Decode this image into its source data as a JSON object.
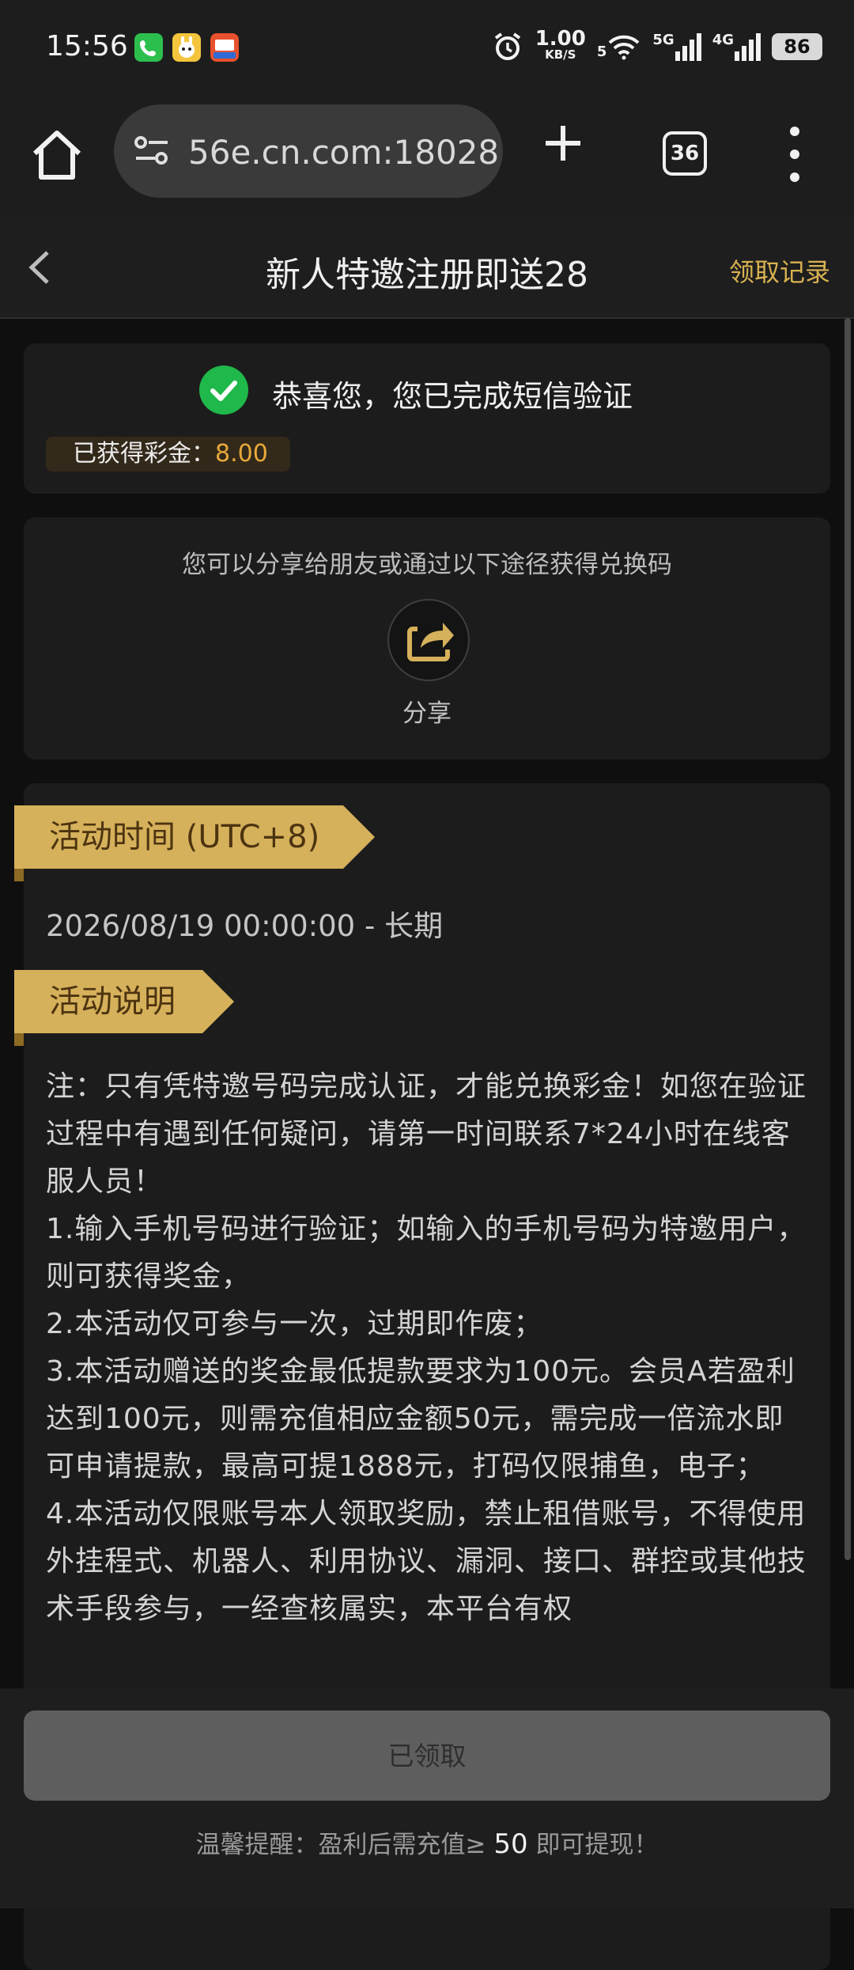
{
  "status_bar": {
    "time": "15:56",
    "speed_value": "1.00",
    "speed_unit": "KB/S",
    "wifi_label": "5",
    "signal1_label": "5G",
    "signal2_label": "4G",
    "battery": "86"
  },
  "browser": {
    "url": "56e.cn.com:18028",
    "tab_count": "36"
  },
  "header": {
    "title": "新人特邀注册即送28",
    "records_link": "领取记录"
  },
  "verification": {
    "message": "恭喜您，您已完成短信验证",
    "bonus_label": "已获得彩金：",
    "bonus_value": "8.00"
  },
  "share": {
    "hint": "您可以分享给朋友或通过以下途径获得兑换码",
    "label": "分享"
  },
  "activity": {
    "time_heading": "活动时间 (UTC+8)",
    "time_range": "2026/08/19 00:00:00 - 长期",
    "desc_heading": "活动说明",
    "desc_lines": [
      "注：只有凭特邀号码完成认证，才能兑换彩金！如您在验证过程中有遇到任何疑问，请第一时间联系7*24小时在线客服人员！",
      "1.输入手机号码进行验证；如输入的手机号码为特邀用户，则可获得奖金，",
      "2.本活动仅可参与一次，过期即作废；",
      "3.本活动赠送的奖金最低提款要求为100元。会员A若盈利达到100元，则需充值相应金额50元，需完成一倍流水即可申请提款，最高可提1888元，打码仅限捕鱼，电子；",
      "4.本活动仅限账号本人领取奖励，禁止租借账号，不得使用外挂程式、机器人、利用协议、漏洞、接口、群控或其他技术手段参与，一经查核属实，本平台有权"
    ]
  },
  "footer": {
    "button_label": "已领取",
    "reminder_prefix": "温馨提醒：盈利后需充值≥",
    "reminder_amount": "50",
    "reminder_suffix": "即可提现！"
  },
  "colors": {
    "accent_gold": "#d6b15b",
    "bonus_orange": "#e8a93a",
    "success_green": "#1fb84a"
  }
}
